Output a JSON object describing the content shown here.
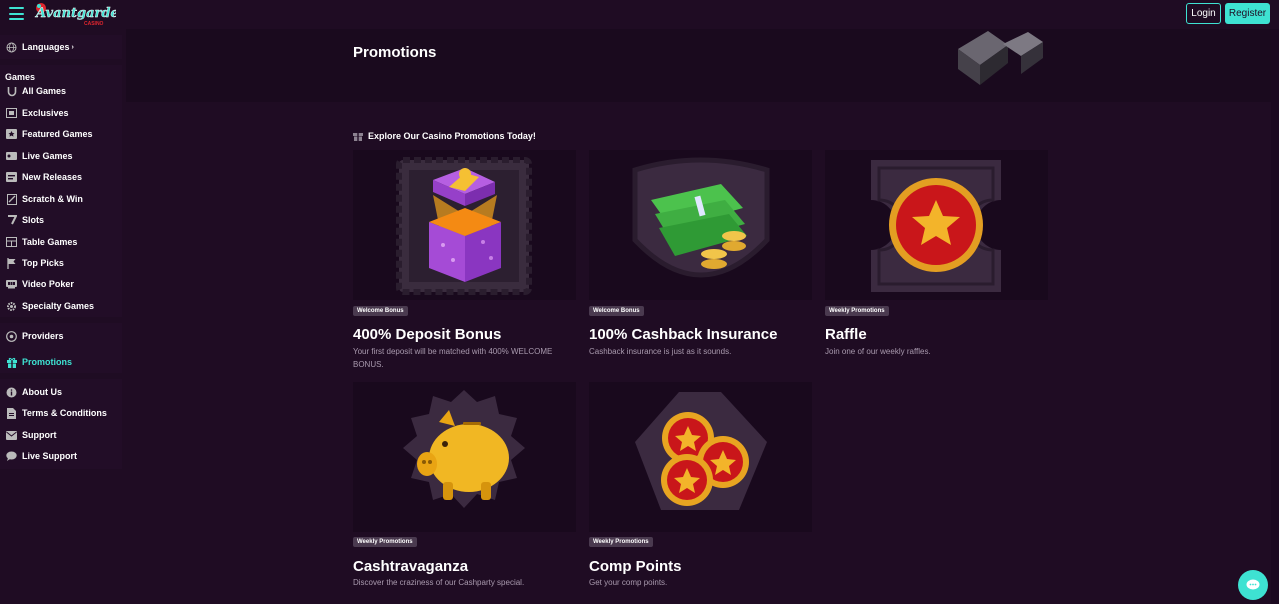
{
  "header": {
    "logo_text": "Avantgarde",
    "logo_sub": "CASINO",
    "login_label": "Login",
    "register_label": "Register"
  },
  "sidebar": {
    "languages_label": "Languages",
    "games_heading": "Games",
    "games": [
      {
        "label": "All Games",
        "icon": "horseshoe-icon"
      },
      {
        "label": "Exclusives",
        "icon": "exclusives-icon"
      },
      {
        "label": "Featured Games",
        "icon": "star-box-icon"
      },
      {
        "label": "Live Games",
        "icon": "live-icon"
      },
      {
        "label": "New Releases",
        "icon": "new-icon"
      },
      {
        "label": "Scratch & Win",
        "icon": "scratch-icon"
      },
      {
        "label": "Slots",
        "icon": "seven-icon"
      },
      {
        "label": "Table Games",
        "icon": "table-icon"
      },
      {
        "label": "Top Picks",
        "icon": "flag-icon"
      },
      {
        "label": "Video Poker",
        "icon": "poker-icon"
      },
      {
        "label": "Specialty Games",
        "icon": "gear-icon"
      }
    ],
    "providers_label": "Providers",
    "promotions_label": "Promotions",
    "info": [
      {
        "label": "About Us",
        "icon": "info-icon"
      },
      {
        "label": "Terms & Conditions",
        "icon": "document-icon"
      },
      {
        "label": "Support",
        "icon": "mail-icon"
      },
      {
        "label": "Live Support",
        "icon": "chat-icon"
      }
    ]
  },
  "main": {
    "title": "Promotions",
    "subheading": "Explore Our Casino Promotions Today!",
    "cards": [
      {
        "badge": "Welcome Bonus",
        "title": "400% Deposit Bonus",
        "desc": "Your first deposit will be matched with 400% WELCOME BONUS."
      },
      {
        "badge": "Welcome Bonus",
        "title": "100% Cashback Insurance",
        "desc": "Cashback insurance is just as it sounds."
      },
      {
        "badge": "Weekly Promotions",
        "title": "Raffle",
        "desc": "Join one of our weekly raffles."
      },
      {
        "badge": "Weekly Promotions",
        "title": "Cashtravaganza",
        "desc": "Discover the craziness of our Cashparty special."
      },
      {
        "badge": "Weekly Promotions",
        "title": "Comp Points",
        "desc": "Get your comp points."
      }
    ]
  },
  "colors": {
    "accent": "#3ee2d2",
    "background": "#1f0c23",
    "card_bg": "#19091d"
  }
}
